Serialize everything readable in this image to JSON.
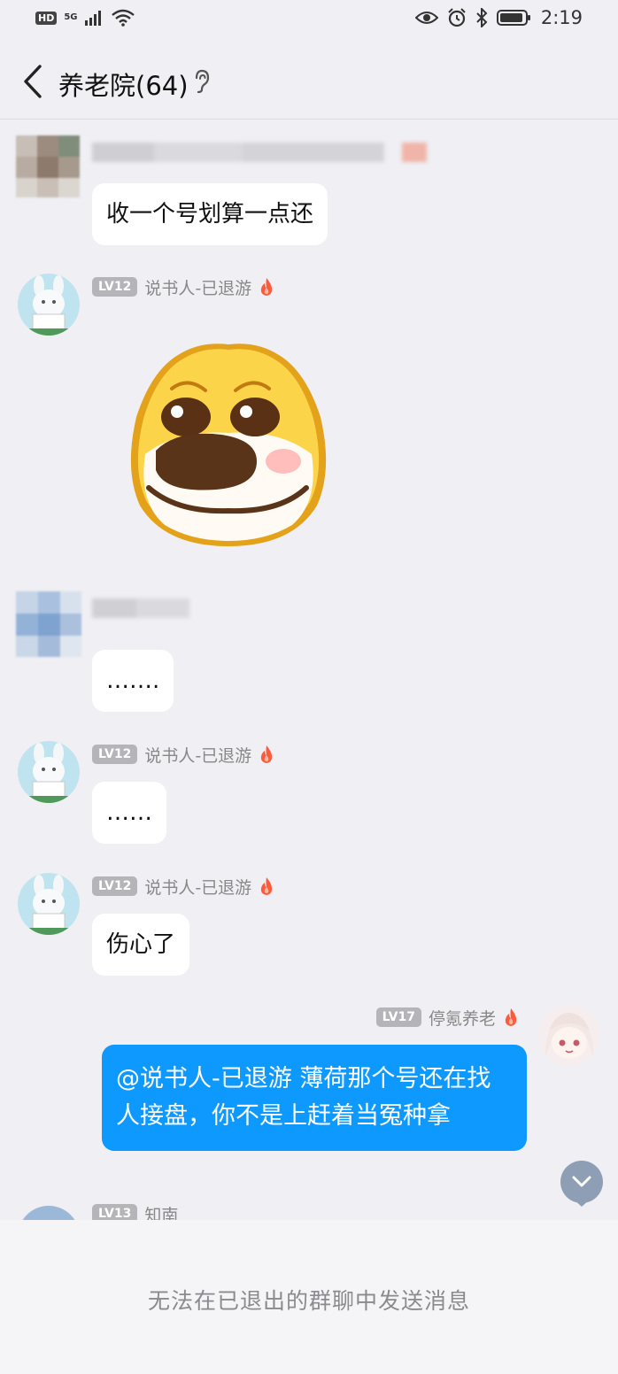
{
  "status_bar": {
    "hd": "HD",
    "network": "5G",
    "time": "2:19",
    "icons": [
      "hd-badge-icon",
      "signal-icon",
      "wifi-icon",
      "eye-icon",
      "alarm-icon",
      "bluetooth-icon",
      "battery-icon"
    ]
  },
  "header": {
    "title": "养老院(64)",
    "back_icon": "chevron-left-icon",
    "ear_icon": "ear-icon"
  },
  "messages": [
    {
      "kind": "incoming",
      "sender_blurred": true,
      "text": "收一个号划算一点还"
    },
    {
      "kind": "incoming",
      "level": "LV12",
      "sender": "说书人-已退游",
      "sticker": "dog-face-sticker",
      "avatar": "white-rabbit-avatar"
    },
    {
      "kind": "incoming",
      "sender_blurred": true,
      "text": "……."
    },
    {
      "kind": "incoming",
      "level": "LV12",
      "sender": "说书人-已退游",
      "text": "……",
      "avatar": "white-rabbit-avatar"
    },
    {
      "kind": "incoming",
      "level": "LV12",
      "sender": "说书人-已退游",
      "text": "伤心了",
      "avatar": "white-rabbit-avatar"
    },
    {
      "kind": "outgoing",
      "level": "LV17",
      "sender": "停氪养老",
      "text": "@说书人-已退游 薄荷那个号还在找人接盘，你不是上赶着当冤种拿",
      "avatar": "anime-girl-avatar"
    },
    {
      "kind": "incoming",
      "level": "LV13",
      "sender": "知南",
      "partial": true
    }
  ],
  "scroll_down_icon": "chevron-down-icon",
  "footer": {
    "notice": "无法在已退出的群聊中发送消息"
  },
  "colors": {
    "background": "#efeff4",
    "outgoing_bubble": "#0d99ff",
    "level_badge": "#b4b4b9",
    "flame": "#ff5a3c"
  }
}
